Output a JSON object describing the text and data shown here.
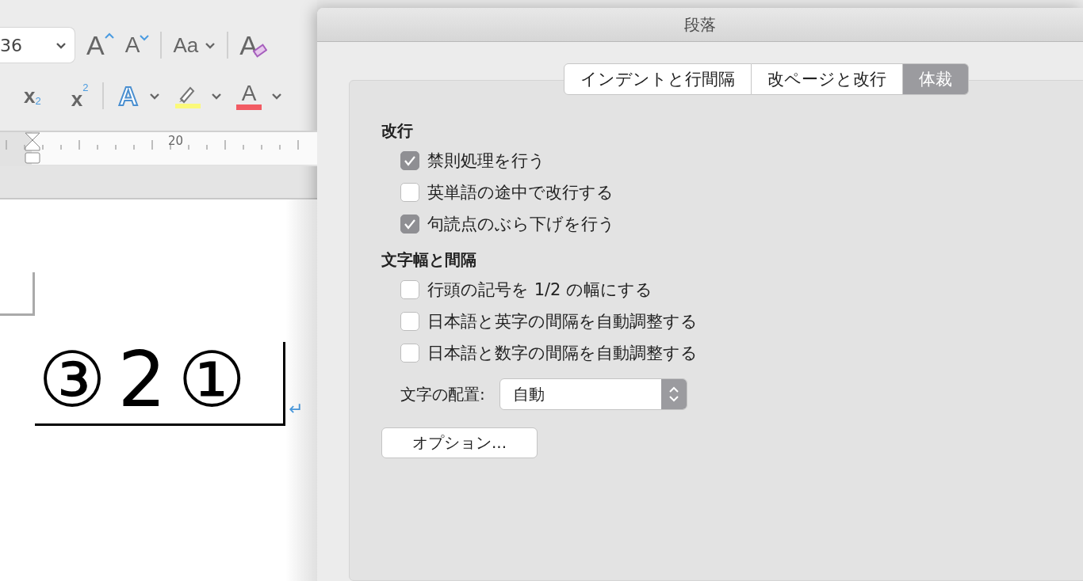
{
  "toolbar": {
    "font_size": "36",
    "grow_font": "A",
    "shrink_font": "A",
    "change_case": "Aa",
    "clear_format": "A",
    "subscript": "x",
    "subscript_mark": "2",
    "superscript": "x",
    "superscript_mark": "2",
    "text_effects": "A",
    "font_color": "A"
  },
  "ruler": {
    "label": "20"
  },
  "document": {
    "text": "③ 2 ①",
    "return_mark": "↵"
  },
  "dialog": {
    "title": "段落",
    "tabs": [
      {
        "label": "インデントと行間隔",
        "selected": false
      },
      {
        "label": "改ページと改行",
        "selected": false
      },
      {
        "label": "体裁",
        "selected": true
      }
    ],
    "sections": [
      {
        "heading": "改行",
        "options": [
          {
            "label": "禁則処理を行う",
            "checked": true
          },
          {
            "label": "英単語の途中で改行する",
            "checked": false
          },
          {
            "label": "句読点のぶら下げを行う",
            "checked": true
          }
        ]
      },
      {
        "heading": "文字幅と間隔",
        "options": [
          {
            "label": "行頭の記号を 1/2 の幅にする",
            "checked": false
          },
          {
            "label": "日本語と英字の間隔を自動調整する",
            "checked": false
          },
          {
            "label": "日本語と数字の間隔を自動調整する",
            "checked": false
          }
        ]
      }
    ],
    "alignment": {
      "label": "文字の配置:",
      "value": "自動"
    },
    "options_button": "オプション..."
  }
}
